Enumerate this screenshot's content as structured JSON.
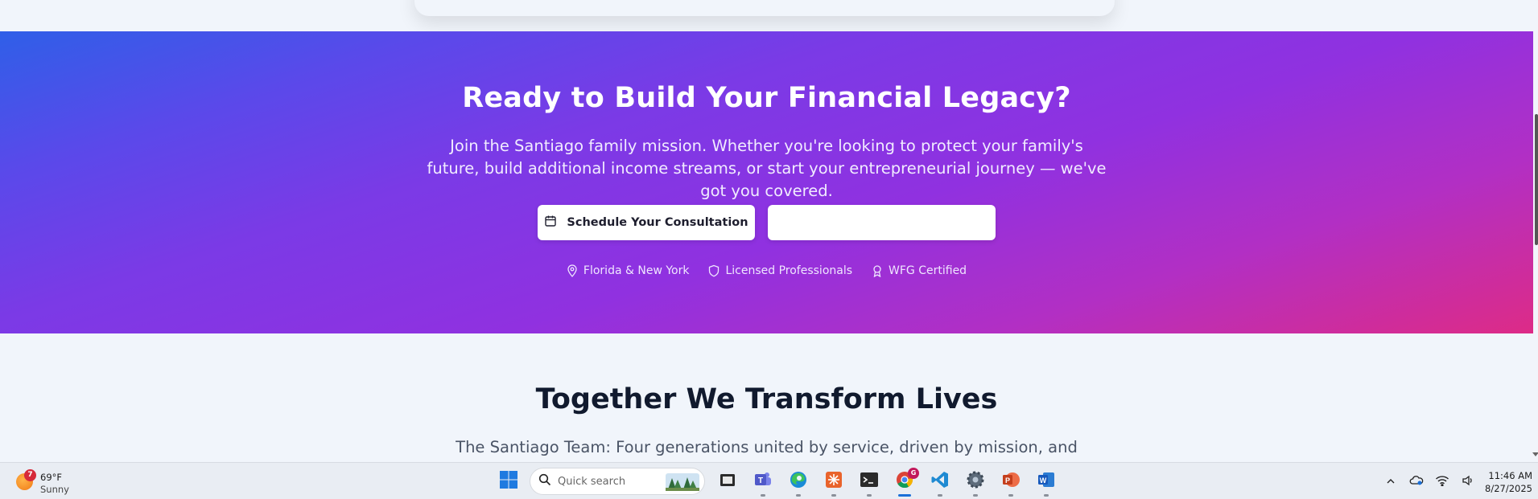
{
  "cta": {
    "title": "Ready to Build Your Financial Legacy?",
    "text": "Join the Santiago family mission. Whether you're looking to protect your family's future, build additional income streams, or start your entrepreneurial journey — we've got you covered.",
    "primary_button": "Schedule Your Consultation",
    "secondary_button": "",
    "badges": [
      {
        "icon": "map-pin-icon",
        "label": "Florida & New York"
      },
      {
        "icon": "shield-icon",
        "label": "Licensed Professionals"
      },
      {
        "icon": "award-icon",
        "label": "WFG Certified"
      }
    ],
    "gradient": [
      "#2f5fe8",
      "#9031e0",
      "#dd2b87"
    ]
  },
  "section": {
    "title": "Together We Transform Lives",
    "text": "The Santiago Team: Four generations united by service, driven by mission, and"
  },
  "taskbar": {
    "weather": {
      "badge": "7",
      "temp": "69°F",
      "condition": "Sunny"
    },
    "search_placeholder": "Quick search",
    "apps": [
      "start-icon",
      "search",
      "file-explorer-icon",
      "teams-icon",
      "edge-icon",
      "app-orange-icon",
      "terminal-icon",
      "chrome-icon",
      "vscode-icon",
      "settings-icon",
      "powerpoint-icon",
      "word-icon"
    ],
    "chrome_badge": "G",
    "time": "11:46 AM",
    "date": "8/27/2025"
  }
}
